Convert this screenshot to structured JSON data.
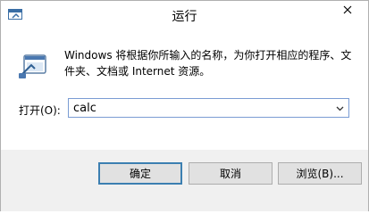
{
  "window": {
    "title": "运行",
    "close_icon": "close-icon"
  },
  "dialog": {
    "description": "Windows 将根据你所输入的名称，为你打开相应的程序、文件夹、文档或 Internet 资源。",
    "open_label": "打开(O):",
    "open_value": "calc",
    "icon": "run-icon"
  },
  "buttons": {
    "ok": "确定",
    "cancel": "取消",
    "browse": "浏览(B)..."
  },
  "colors": {
    "focus_border": "#7a9cd3",
    "default_button_border": "#3c7fb1",
    "footer_bg": "#f0f0f0"
  }
}
